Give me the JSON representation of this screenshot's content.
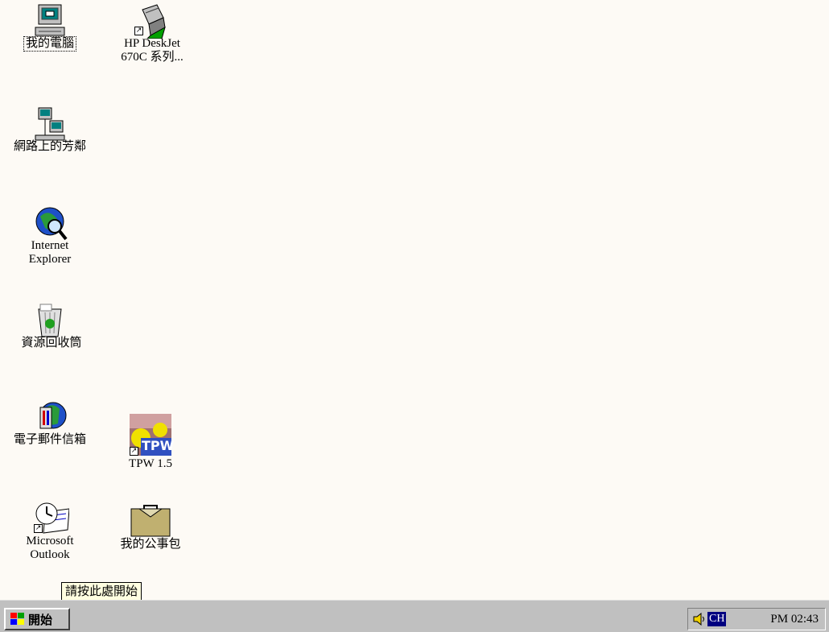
{
  "desktop": {
    "icons": {
      "my_computer": {
        "label": "我的電腦"
      },
      "hp_printer": {
        "label": "HP DeskJet 670C 系列..."
      },
      "network": {
        "label": "網路上的芳鄰"
      },
      "ie": {
        "label": "Internet Explorer"
      },
      "recycle_bin": {
        "label": "資源回收筒"
      },
      "inbox": {
        "label": "電子郵件信箱"
      },
      "tpw": {
        "label": "TPW 1.5",
        "icon_text": "TPW"
      },
      "outlook": {
        "label": "Microsoft Outlook"
      },
      "briefcase": {
        "label": "我的公事包"
      }
    }
  },
  "tooltip": {
    "text": "請按此處開始"
  },
  "taskbar": {
    "start_label": "開始",
    "tray": {
      "ime_label": "CH",
      "clock": "PM 02:43"
    }
  },
  "colors": {
    "desktop_bg": "#fdfaf5",
    "taskbar_bg": "#c0c0c0",
    "ime_bg": "#000080"
  }
}
